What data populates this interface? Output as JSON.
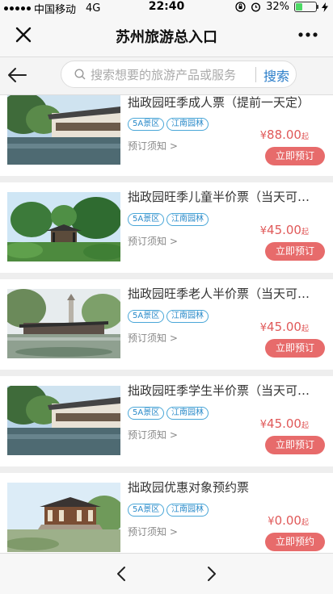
{
  "status": {
    "carrier": "中国移动",
    "network": "4G",
    "time": "22:40",
    "battery_text": "32%",
    "battery_level": 0.32
  },
  "nav": {
    "title": "苏州旅游总入口"
  },
  "search": {
    "placeholder": "搜索想要的旅游产品或服务",
    "button_label": "搜索"
  },
  "products": [
    {
      "name": "拙政园旺季成人票（提前一天定）",
      "tags": [
        "5A景区",
        "江南园林"
      ],
      "notice": "预订须知 >",
      "currency": "¥",
      "price": "88.00",
      "unit": "起",
      "button": "立即预订"
    },
    {
      "name": "拙政园旺季儿童半价票（当天可…",
      "tags": [
        "5A景区",
        "江南园林"
      ],
      "notice": "预订须知 >",
      "currency": "¥",
      "price": "45.00",
      "unit": "起",
      "button": "立即预订"
    },
    {
      "name": "拙政园旺季老人半价票（当天可…",
      "tags": [
        "5A景区",
        "江南园林"
      ],
      "notice": "预订须知 >",
      "currency": "¥",
      "price": "45.00",
      "unit": "起",
      "button": "立即预订"
    },
    {
      "name": "拙政园旺季学生半价票（当天可…",
      "tags": [
        "5A景区",
        "江南园林"
      ],
      "notice": "预订须知 >",
      "currency": "¥",
      "price": "45.00",
      "unit": "起",
      "button": "立即预订"
    },
    {
      "name": "拙政园优惠对象预约票",
      "tags": [
        "5A景区",
        "江南园林"
      ],
      "notice": "预订须知 >",
      "currency": "¥",
      "price": "0.00",
      "unit": "起",
      "button": "立即预约"
    }
  ],
  "icons": {
    "close": "close-icon",
    "more": "more-icon",
    "back": "back-arrow-icon",
    "search": "search-icon",
    "prev": "chevron-left-icon",
    "next": "chevron-right-icon"
  }
}
